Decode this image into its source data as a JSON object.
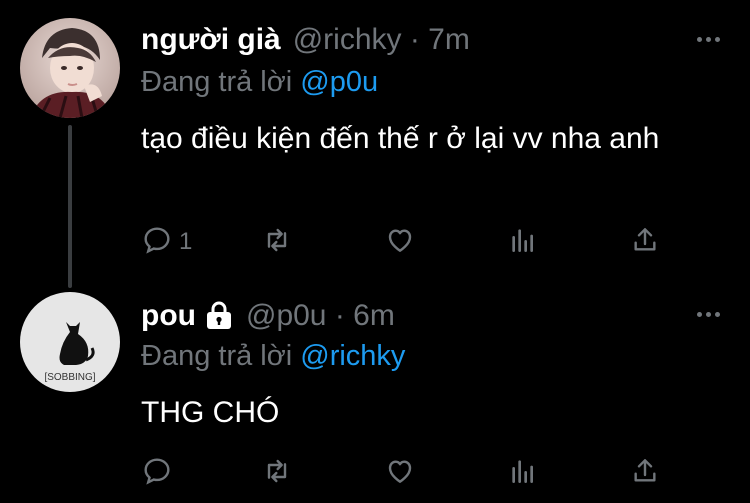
{
  "tweets": [
    {
      "display_name": "người già",
      "handle_time": "@richky · 7m",
      "reply_prefix": "Đang trả lời",
      "reply_mention": "@p0u",
      "text": "tạo điều kiện đến thế r ở lại vv nha anh",
      "reply_count": "1",
      "protected": false
    },
    {
      "display_name": "pou",
      "handle_time": "@p0u · 6m",
      "reply_prefix": "Đang trả lời",
      "reply_mention": "@richky",
      "text": "THG CHÓ",
      "reply_count": "",
      "avatar_caption": "[SOBBING]",
      "protected": true
    }
  ],
  "icons": {
    "reply": "reply-icon",
    "retweet": "retweet-icon",
    "like": "heart-icon",
    "stats": "stats-icon",
    "share": "share-icon",
    "more": "more-icon",
    "lock": "lock-icon"
  },
  "colors": {
    "background": "#000000",
    "text": "#ffffff",
    "secondary": "#71767b",
    "mention": "#1d9bf0",
    "thread_line": "#3a3d40"
  }
}
